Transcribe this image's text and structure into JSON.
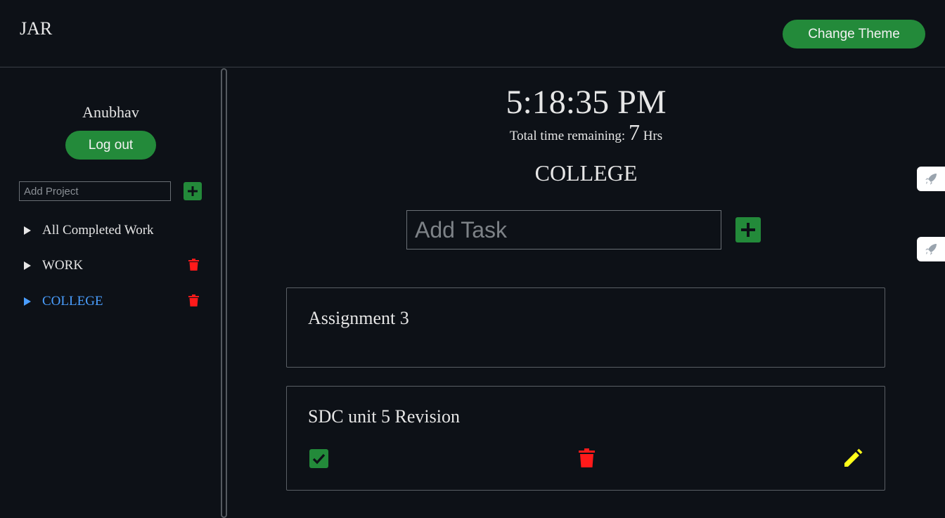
{
  "header": {
    "brand": "JAR",
    "change_theme_label": "Change Theme"
  },
  "sidebar": {
    "username": "Anubhav",
    "logout_label": "Log out",
    "add_project_placeholder": "Add Project",
    "items": [
      {
        "label": "All Completed Work",
        "deletable": false,
        "active": false
      },
      {
        "label": "WORK",
        "deletable": true,
        "active": false
      },
      {
        "label": "COLLEGE",
        "deletable": true,
        "active": true
      }
    ]
  },
  "main": {
    "clock": "5:18:35 PM",
    "remaining_prefix": "Total time remaining:",
    "remaining_value": "7",
    "remaining_unit": "Hrs",
    "project_title": "COLLEGE",
    "add_task_placeholder": "Add Task",
    "tasks": [
      {
        "title": "Assignment 3"
      },
      {
        "title": "SDC unit 5 Revision"
      }
    ]
  },
  "icons": {
    "plus": "plus-icon",
    "triangle": "triangle-right-icon",
    "trash": "trash-icon",
    "check": "checkbox-check-icon",
    "edit": "pencil-icon",
    "side_tab": "rocket-icon"
  },
  "colors": {
    "background": "#0d1117",
    "accent_green": "#238a3a",
    "active_blue": "#4a9eff",
    "delete_red": "#ff1a1a",
    "edit_yellow": "#ffff1a"
  }
}
